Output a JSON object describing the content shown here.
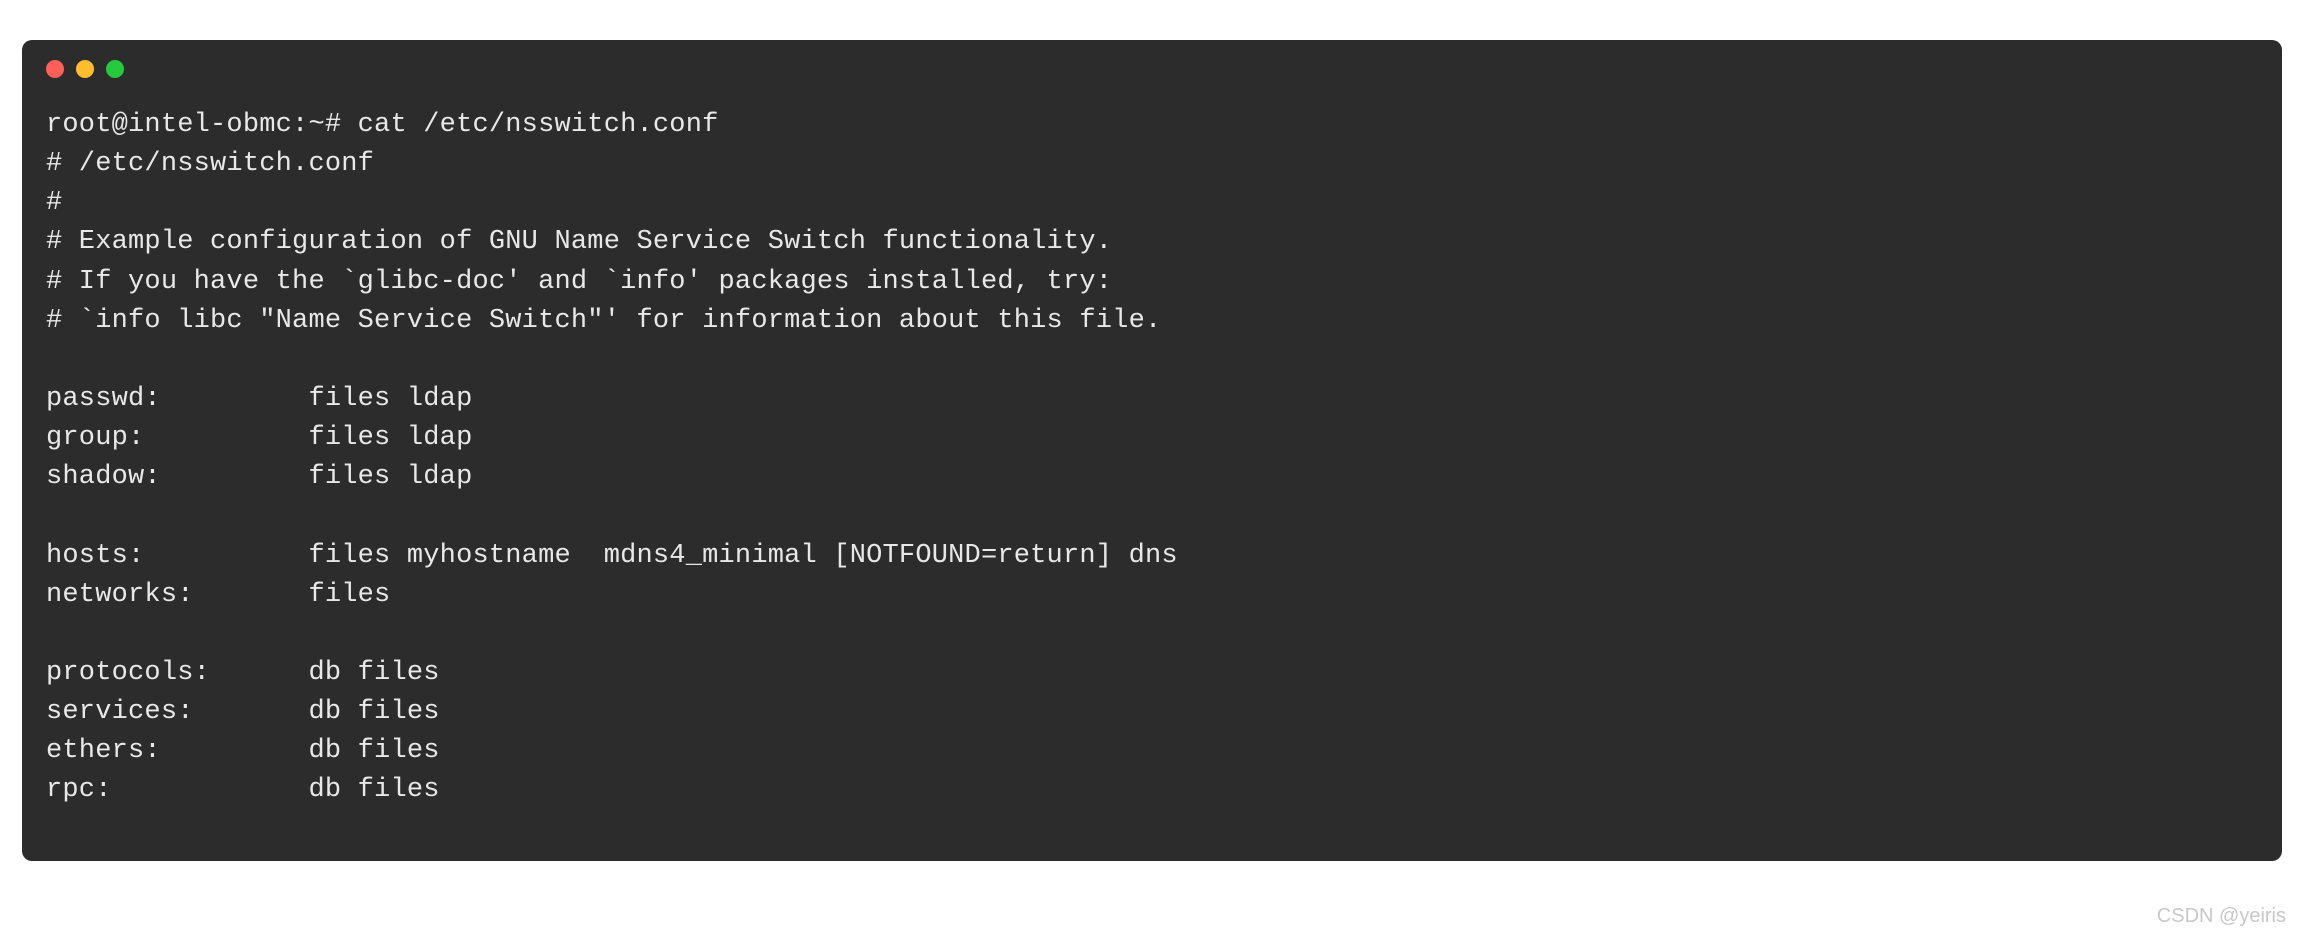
{
  "terminal": {
    "prompt": "root@intel-obmc:~# ",
    "command": "cat /etc/nsswitch.conf",
    "lines": [
      "# /etc/nsswitch.conf",
      "#",
      "# Example configuration of GNU Name Service Switch functionality.",
      "# If you have the `glibc-doc' and `info' packages installed, try:",
      "# `info libc \"Name Service Switch\"' for information about this file.",
      "",
      "passwd:         files ldap",
      "group:          files ldap",
      "shadow:         files ldap",
      "",
      "hosts:          files myhostname  mdns4_minimal [NOTFOUND=return] dns",
      "networks:       files",
      "",
      "protocols:      db files",
      "services:       db files",
      "ethers:         db files",
      "rpc:            db files"
    ]
  },
  "watermark": "CSDN @yeiris"
}
